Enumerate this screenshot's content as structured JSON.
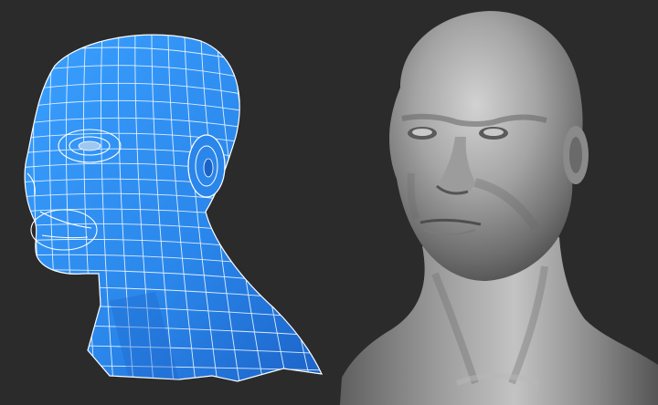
{
  "scene": {
    "background": "#2b2b2b",
    "left_model": {
      "kind": "wireframe-head",
      "fill": "#2f8ff0",
      "fill_dark": "#1f6ed8",
      "wire": "#ffffff"
    },
    "right_model": {
      "kind": "shaded-head",
      "base": "#8f8f8f",
      "highlight": "#d6d6d6",
      "shadow": "#4a4a4a"
    }
  }
}
